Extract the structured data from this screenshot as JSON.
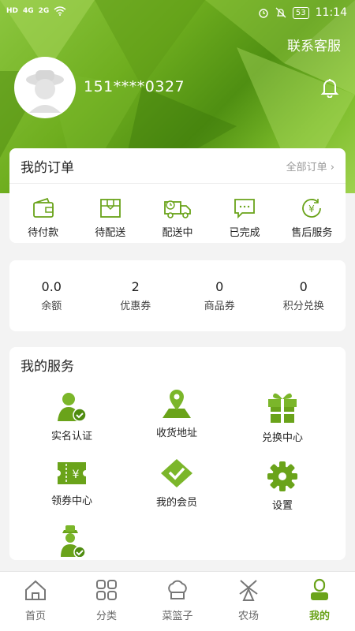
{
  "status": {
    "left_icons": [
      "HD",
      "4G",
      "2G",
      "wifi"
    ],
    "time": "11:14",
    "battery": "53"
  },
  "header": {
    "contact_label": "联系客服",
    "phone": "151****0327"
  },
  "orders": {
    "title": "我的订单",
    "all_label": "全部订单 ›",
    "items": [
      {
        "label": "待付款",
        "icon": "wallet-icon"
      },
      {
        "label": "待配送",
        "icon": "package-icon"
      },
      {
        "label": "配送中",
        "icon": "truck-icon"
      },
      {
        "label": "已完成",
        "icon": "chat-icon"
      },
      {
        "label": "售后服务",
        "icon": "refund-icon"
      }
    ]
  },
  "assets": {
    "items": [
      {
        "value": "0.0",
        "label": "余额"
      },
      {
        "value": "2",
        "label": "优惠券"
      },
      {
        "value": "0",
        "label": "商品券"
      },
      {
        "value": "0",
        "label": "积分兑换"
      }
    ]
  },
  "services": {
    "title": "我的服务",
    "items": [
      {
        "label": "实名认证",
        "icon": "verified-user-icon"
      },
      {
        "label": "收货地址",
        "icon": "location-pin-icon"
      },
      {
        "label": "兑换中心",
        "icon": "gift-icon"
      },
      {
        "label": "领券中心",
        "icon": "coupon-icon"
      },
      {
        "label": "我的会员",
        "icon": "member-check-icon"
      },
      {
        "label": "设置",
        "icon": "gear-icon"
      },
      {
        "label": "",
        "icon": "farmer-icon"
      }
    ]
  },
  "tabs": [
    {
      "label": "首页",
      "icon": "home-icon"
    },
    {
      "label": "分类",
      "icon": "category-icon"
    },
    {
      "label": "菜篮子",
      "icon": "basket-icon"
    },
    {
      "label": "农场",
      "icon": "farm-icon"
    },
    {
      "label": "我的",
      "icon": "profile-icon"
    }
  ],
  "colors": {
    "accent": "#6aa31a",
    "hero": "#6fae1f"
  }
}
